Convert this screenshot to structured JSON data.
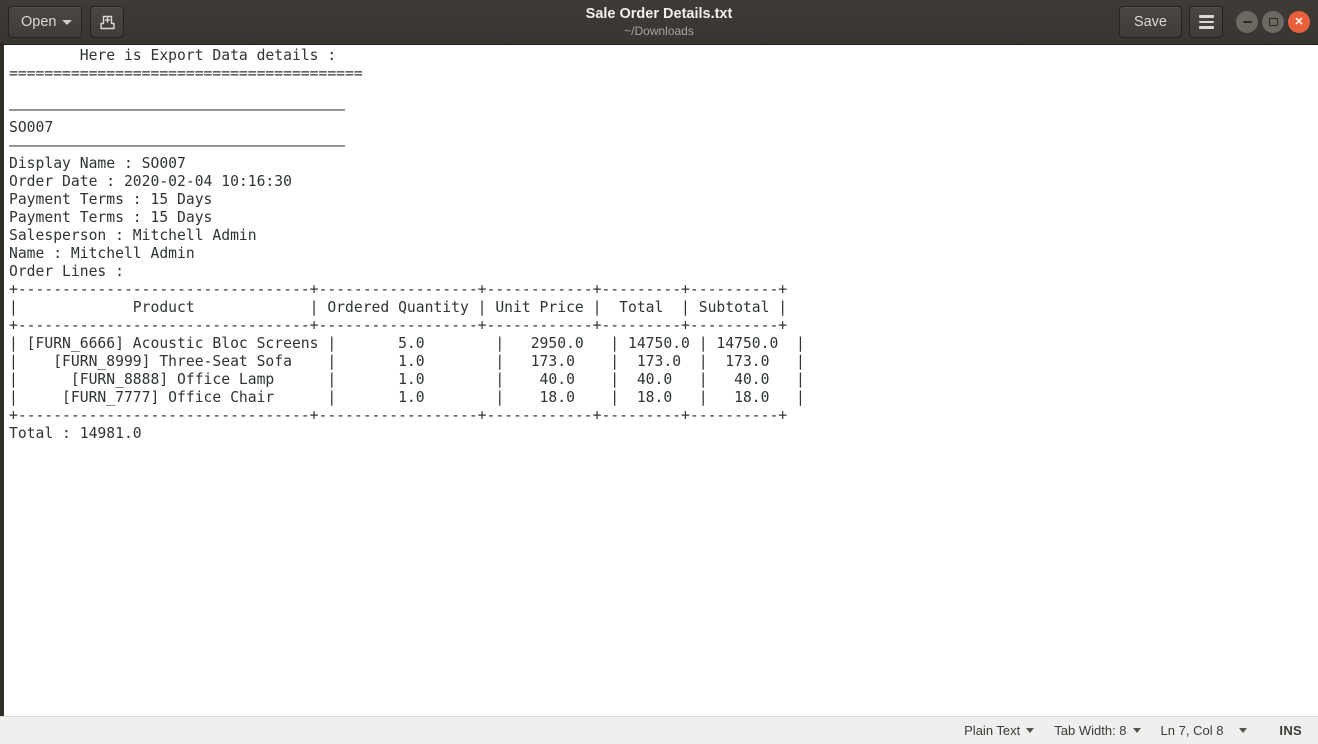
{
  "window": {
    "title": "Sale Order Details.txt",
    "subtitle": "~/Downloads",
    "open_label": "Open",
    "new_doc_icon": "new-document-icon",
    "save_label": "Save",
    "menu_icon": "hamburger-menu-icon",
    "minimize_icon": "minimize-icon",
    "maximize_icon": "maximize-icon",
    "close_icon": "close-icon"
  },
  "document": {
    "heading": "        Here is Export Data details :",
    "rule_equals": "========================================",
    "blank_1": "",
    "rule_dash_top": "——————————————————————————————————————",
    "record_id": "SO007",
    "rule_dash_bottom": "——————————————————————————————————————",
    "fields": [
      "Display Name : SO007",
      "Order Date : 2020-02-04 10:16:30",
      "Payment Terms : 15 Days",
      "Payment Terms : 15 Days",
      "Salesperson : Mitchell Admin",
      "Name : Mitchell Admin",
      "Order Lines :"
    ],
    "table": {
      "border": "+---------------------------------+------------------+------------+---------+----------+",
      "headers": [
        "Product",
        "Ordered Quantity",
        "Unit Price",
        "Total",
        "Subtotal"
      ],
      "header_row": "|             Product             | Ordered Quantity | Unit Price |  Total  | Subtotal |",
      "rows": [
        {
          "product": "[FURN_6666] Acoustic Bloc Screens",
          "ordered_quantity": "5.0",
          "unit_price": "2950.0",
          "total": "14750.0",
          "subtotal": "14750.0",
          "line": "| [FURN_6666] Acoustic Bloc Screens |       5.0        |   2950.0   | 14750.0 | 14750.0  |"
        },
        {
          "product": "[FURN_8999] Three-Seat Sofa",
          "ordered_quantity": "1.0",
          "unit_price": "173.0",
          "total": "173.0",
          "subtotal": "173.0",
          "line": "|    [FURN_8999] Three-Seat Sofa    |       1.0        |   173.0    |  173.0  |  173.0   |"
        },
        {
          "product": "[FURN_8888] Office Lamp",
          "ordered_quantity": "1.0",
          "unit_price": "40.0",
          "total": "40.0",
          "subtotal": "40.0",
          "line": "|      [FURN_8888] Office Lamp      |       1.0        |    40.0    |  40.0   |   40.0   |"
        },
        {
          "product": "[FURN_7777] Office Chair",
          "ordered_quantity": "1.0",
          "unit_price": "18.0",
          "total": "18.0",
          "subtotal": "18.0",
          "line": "|     [FURN_7777] Office Chair      |       1.0        |    18.0    |  18.0   |   18.0   |"
        }
      ]
    },
    "total_line": "Total : 14981.0",
    "body": "        Here is Export Data details :\n========================================\n\n——————————————————————————————————————\nSO007\n——————————————————————————————————————\nDisplay Name : SO007\nOrder Date : 2020-02-04 10:16:30\nPayment Terms : 15 Days\nPayment Terms : 15 Days\nSalesperson : Mitchell Admin\nName : Mitchell Admin\nOrder Lines :\n+---------------------------------+------------------+------------+---------+----------+\n|             Product             | Ordered Quantity | Unit Price |  Total  | Subtotal |\n+---------------------------------+------------------+------------+---------+----------+\n| [FURN_6666] Acoustic Bloc Screens |       5.0        |   2950.0   | 14750.0 | 14750.0  |\n|    [FURN_8999] Three-Seat Sofa    |       1.0        |   173.0    |  173.0  |  173.0   |\n|      [FURN_8888] Office Lamp      |       1.0        |    40.0    |  40.0   |   40.0   |\n|     [FURN_7777] Office Chair      |       1.0        |    18.0    |  18.0   |   18.0   |\n+---------------------------------+------------------+------------+---------+----------+\nTotal : 14981.0"
  },
  "statusbar": {
    "language": "Plain Text",
    "tab_width": "Tab Width: 8",
    "position": "Ln 7, Col 8",
    "insert_mode": "INS"
  },
  "colors": {
    "titlebar": "#3e3b37",
    "close_button": "#e8613c",
    "document_bg": "#ffffff",
    "document_text": "#2e3436",
    "statusbar_bg": "#f0efee"
  }
}
